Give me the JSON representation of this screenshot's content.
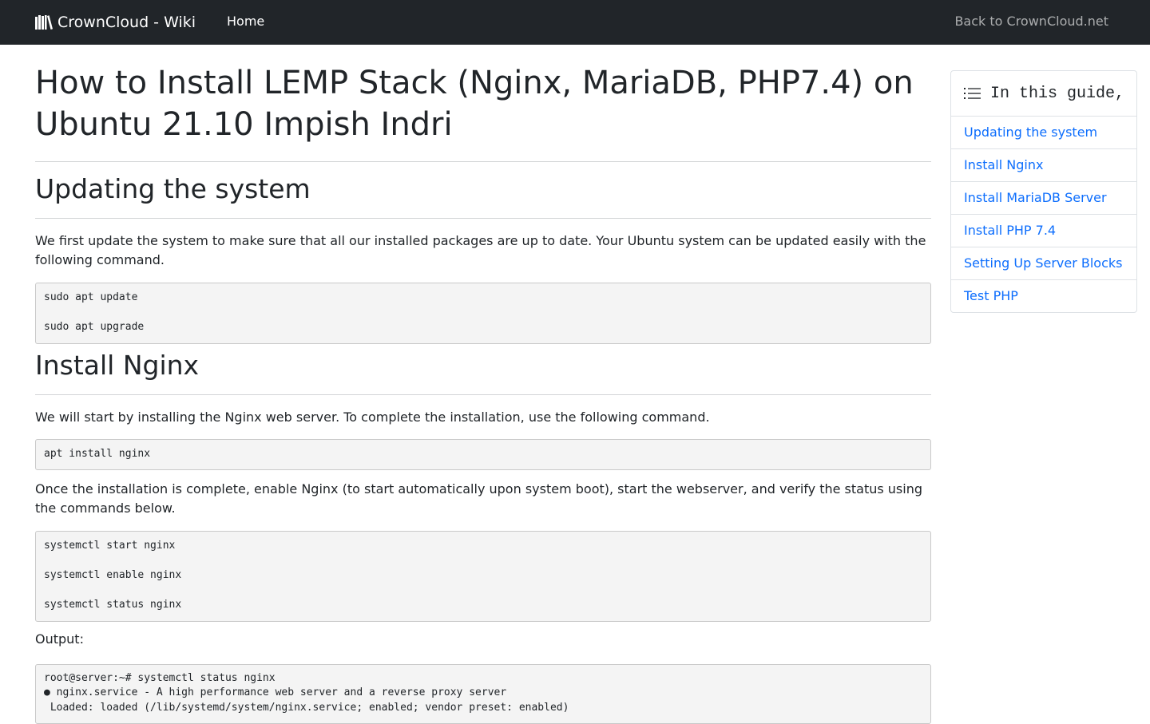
{
  "navbar": {
    "brand": "CrownCloud - Wiki",
    "brand_icon": "books-icon",
    "home": "Home",
    "back": "Back to CrownCloud.net"
  },
  "article": {
    "title": "How to Install LEMP Stack (Nginx, MariaDB, PHP7.4) on Ubuntu 21.10 Impish Indri",
    "sections": [
      {
        "heading": "Updating the system",
        "paragraph": "We first update the system to make sure that all our installed packages are up to date. Your Ubuntu system can be updated easily with the following command.",
        "code": [
          "sudo apt update",
          "sudo apt upgrade"
        ]
      },
      {
        "heading": "Install Nginx",
        "paragraph": "We will start by installing the Nginx web server. To complete the installation, use the following command.",
        "code": [
          "apt install nginx"
        ],
        "paragraph2": "Once the installation is complete, enable Nginx (to start automatically upon system boot), start the webserver, and verify the status using the commands below.",
        "code2": [
          "systemctl start nginx",
          "systemctl enable nginx",
          "systemctl status nginx"
        ],
        "output_label": "Output:",
        "output": [
          "root@server:~# systemctl status nginx",
          "● nginx.service - A high performance web server and a reverse proxy server",
          " Loaded: loaded (/lib/systemd/system/nginx.service; enabled; vendor preset: enabled)"
        ]
      }
    ]
  },
  "toc": {
    "icon": "list-icon",
    "title": "In this guide,",
    "items": [
      "Updating the system",
      "Install Nginx",
      "Install MariaDB Server",
      "Install PHP 7.4",
      "Setting Up Server Blocks",
      "Test PHP"
    ]
  },
  "colors": {
    "navbar_bg": "#212529",
    "link": "#0d6efd",
    "code_bg": "#f4f4f4"
  }
}
